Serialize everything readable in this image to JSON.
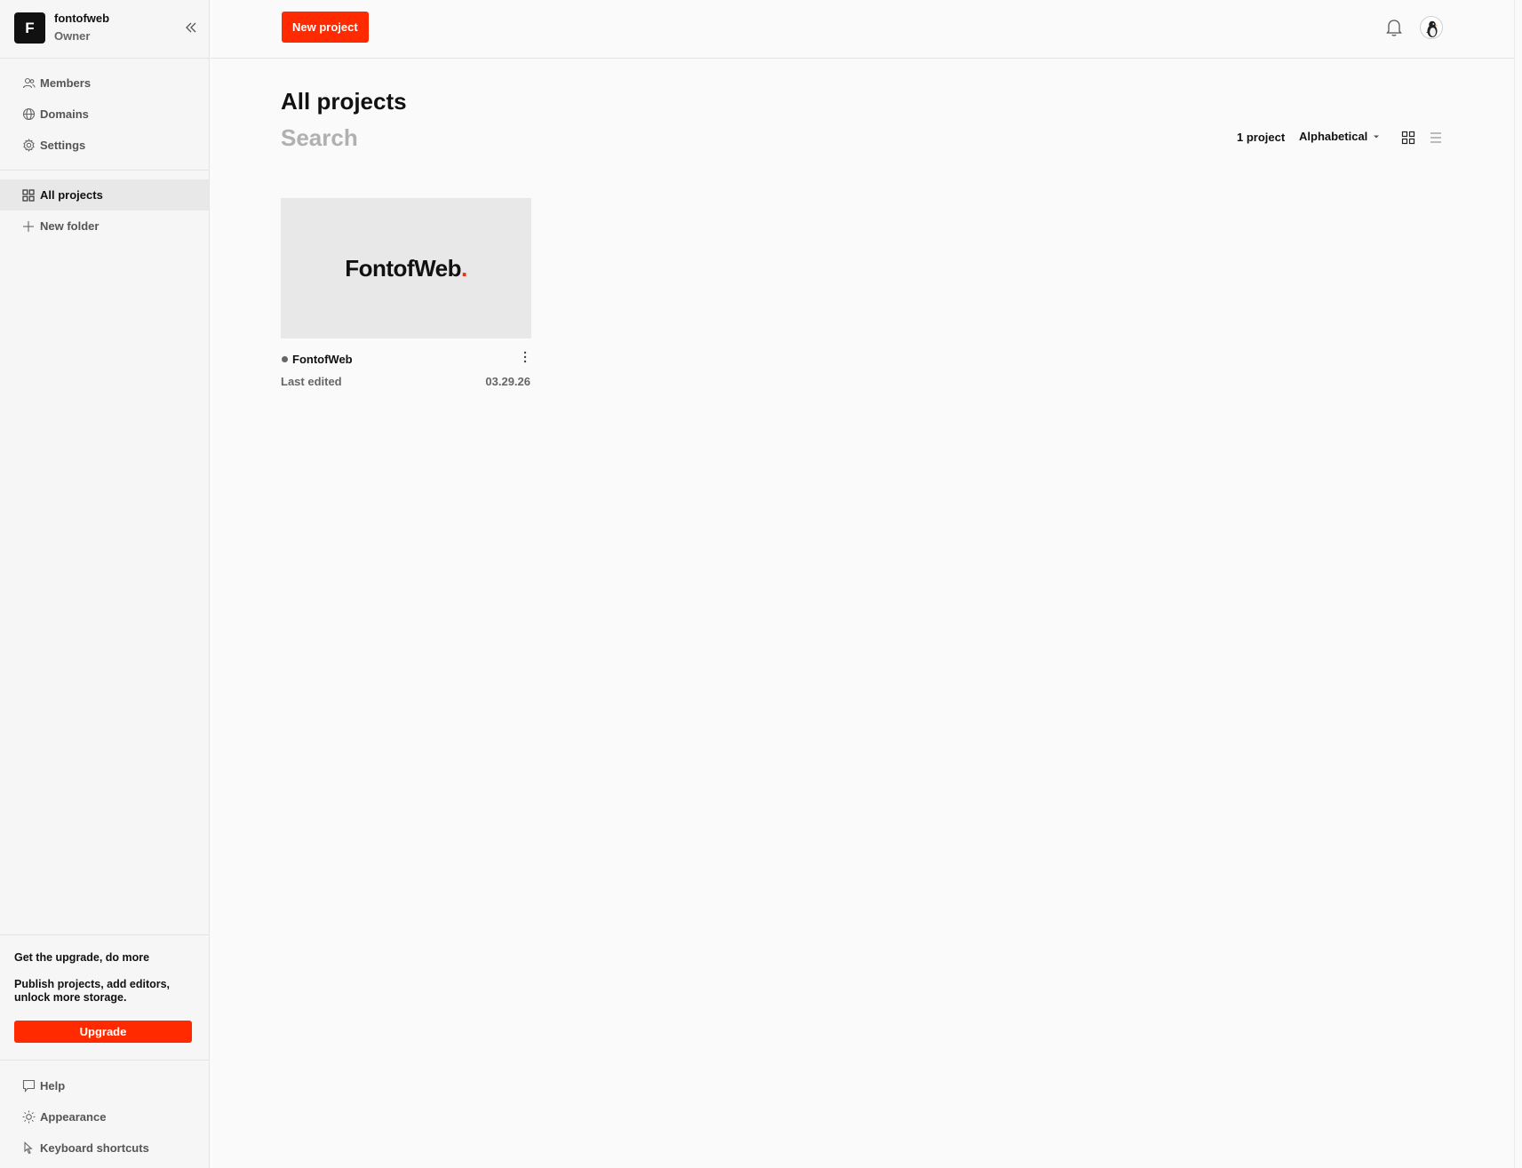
{
  "workspace": {
    "initial": "F",
    "name": "fontofweb",
    "role": "Owner"
  },
  "sidebar": {
    "top_items": [
      {
        "label": "Members",
        "icon": "members-icon"
      },
      {
        "label": "Domains",
        "icon": "globe-icon"
      },
      {
        "label": "Settings",
        "icon": "gear-icon"
      }
    ],
    "project_items": [
      {
        "label": "All projects",
        "icon": "grid-icon",
        "active": true
      },
      {
        "label": "New folder",
        "icon": "plus-icon"
      }
    ],
    "upgrade": {
      "title": "Get the upgrade, do more",
      "description": "Publish projects, add editors, unlock more storage.",
      "button_label": "Upgrade"
    },
    "bottom_items": [
      {
        "label": "Help",
        "icon": "chat-bubble-icon"
      },
      {
        "label": "Appearance",
        "icon": "sun-icon"
      },
      {
        "label": "Keyboard shortcuts",
        "icon": "pointer-icon"
      }
    ]
  },
  "topbar": {
    "new_project_label": "New project"
  },
  "main": {
    "title": "All projects",
    "search_placeholder": "Search",
    "project_count": "1 project",
    "sort_label": "Alphabetical",
    "projects": [
      {
        "name": "FontofWeb",
        "thumbnail_text": "FontofWeb",
        "thumbnail_dot": ".",
        "edited_label": "Last edited",
        "date": "03.29.26"
      }
    ]
  },
  "colors": {
    "accent": "#ff2a00",
    "sidebar_bg": "#f6f6f6",
    "page_bg": "#fafafa",
    "thumb_bg": "#e8e8e8"
  }
}
